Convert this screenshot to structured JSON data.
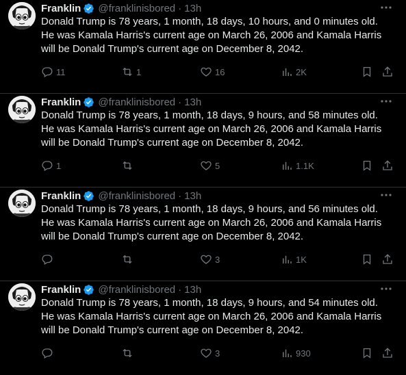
{
  "tweets": [
    {
      "name": "Franklin",
      "handle": "@franklinisbored",
      "dot": "·",
      "time": "13h",
      "text": "Donald Trump is 78 years, 1 month, 18 days, 10 hours, and 0 minutes old.\nHe was Kamala Harris's current age on March 26, 2006 and Kamala Harris\nwill be Donald Trump's current age on December 8, 2042.",
      "replies": "11",
      "reposts": "1",
      "likes": "16",
      "views": "2K"
    },
    {
      "name": "Franklin",
      "handle": "@franklinisbored",
      "dot": "·",
      "time": "13h",
      "text": "Donald Trump is 78 years, 1 month, 18 days, 9 hours, and 58 minutes old.\nHe was Kamala Harris's current age on March 26, 2006 and Kamala Harris\nwill be Donald Trump's current age on December 8, 2042.",
      "replies": "1",
      "reposts": "",
      "likes": "5",
      "views": "1.1K"
    },
    {
      "name": "Franklin",
      "handle": "@franklinisbored",
      "dot": "·",
      "time": "13h",
      "text": "Donald Trump is 78 years, 1 month, 18 days, 9 hours, and 56 minutes old.\nHe was Kamala Harris's current age on March 26, 2006 and Kamala Harris\nwill be Donald Trump's current age on December 8, 2042.",
      "replies": "",
      "reposts": "",
      "likes": "3",
      "views": "1K"
    },
    {
      "name": "Franklin",
      "handle": "@franklinisbored",
      "dot": "·",
      "time": "13h",
      "text": "Donald Trump is 78 years, 1 month, 18 days, 9 hours, and 54 minutes old.\nHe was Kamala Harris's current age on March 26, 2006 and Kamala Harris\nwill be Donald Trump's current age on December 8, 2042.",
      "replies": "",
      "reposts": "",
      "likes": "3",
      "views": "930"
    }
  ],
  "icons": {
    "verified": "verified-badge-icon",
    "more": "more-icon",
    "reply": "reply-icon",
    "repost": "repost-icon",
    "like": "heart-icon",
    "views": "views-icon",
    "bookmark": "bookmark-icon",
    "share": "share-icon"
  },
  "colors": {
    "background": "#000000",
    "text": "#e7e9ea",
    "muted": "#71767b",
    "verified": "#1d9bf0",
    "divider": "#2f3336"
  }
}
